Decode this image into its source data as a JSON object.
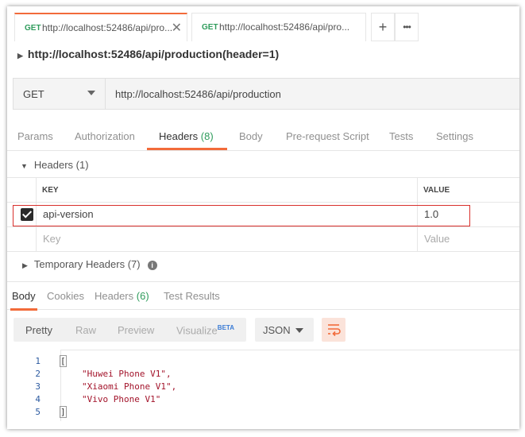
{
  "tabs": [
    {
      "method": "GET",
      "url": "http://localhost:52486/api/pro...",
      "close": "✕",
      "active": true
    },
    {
      "method": "GET",
      "url": "http://localhost:52486/api/pro...",
      "active": false
    }
  ],
  "tab_actions": {
    "add": "+",
    "more": "•••"
  },
  "breadcrumb": "http://localhost:52486/api/production(header=1)",
  "request": {
    "method": "GET",
    "url": "http://localhost:52486/api/production"
  },
  "request_tabs": [
    {
      "label": "Params",
      "count": ""
    },
    {
      "label": "Authorization",
      "count": ""
    },
    {
      "label": "Headers",
      "count": "(8)"
    },
    {
      "label": "Body",
      "count": ""
    },
    {
      "label": "Pre-request Script",
      "count": ""
    },
    {
      "label": "Tests",
      "count": ""
    },
    {
      "label": "Settings",
      "count": ""
    }
  ],
  "headers_section": {
    "title": "Headers (1)",
    "key_col": "KEY",
    "value_col": "VALUE",
    "rows": [
      {
        "key": "api-version",
        "value": "1.0",
        "checked": true
      }
    ],
    "placeholder": {
      "key": "Key",
      "value": "Value"
    }
  },
  "temp_headers": {
    "title": "Temporary Headers (7)",
    "info": "i"
  },
  "response_tabs": [
    {
      "label": "Body",
      "count": ""
    },
    {
      "label": "Cookies",
      "count": ""
    },
    {
      "label": "Headers",
      "count": "(6)"
    },
    {
      "label": "Test Results",
      "count": ""
    }
  ],
  "format": {
    "options": [
      "Pretty",
      "Raw",
      "Preview",
      "Visualize"
    ],
    "beta": "BETA",
    "language": "JSON"
  },
  "response_body": {
    "lines": [
      {
        "n": "1",
        "text": "["
      },
      {
        "n": "2",
        "text": "\"Huwei Phone V1\","
      },
      {
        "n": "3",
        "text": "\"Xiaomi Phone V1\","
      },
      {
        "n": "4",
        "text": "\"Vivo Phone V1\""
      },
      {
        "n": "5",
        "text": "]"
      }
    ]
  },
  "colors": {
    "accent": "#f26b3a",
    "get": "#2f9c5c",
    "highlight": "#d9302c"
  }
}
